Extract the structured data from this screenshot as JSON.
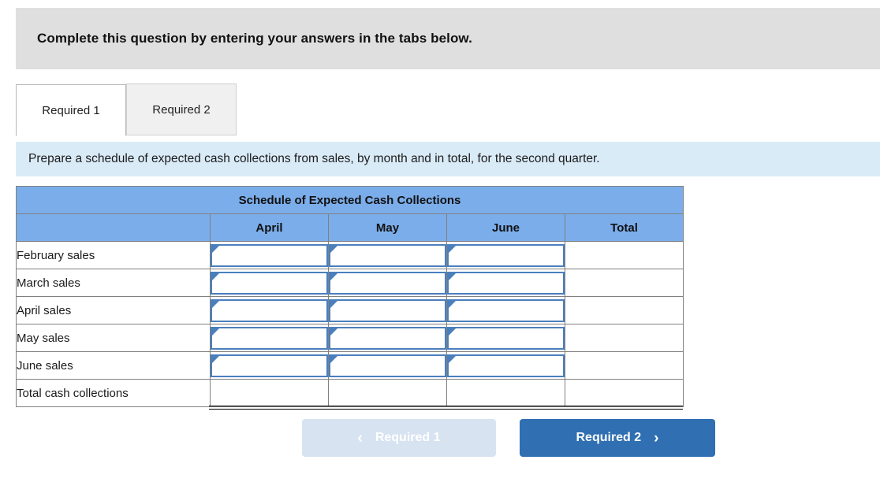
{
  "banner": {
    "text": "Complete this question by entering your answers in the tabs below."
  },
  "tabs": [
    {
      "label": "Required 1",
      "state": "active"
    },
    {
      "label": "Required 2",
      "state": "inactive"
    }
  ],
  "instruction": {
    "text": "Prepare a schedule of expected cash collections from sales, by month and in total, for the second quarter."
  },
  "worksheet": {
    "title": "Schedule of Expected Cash Collections",
    "columns": [
      "",
      "April",
      "May",
      "June",
      "Total"
    ],
    "rows": [
      {
        "label": "February sales",
        "inputs": [
          "",
          "",
          ""
        ],
        "total": ""
      },
      {
        "label": "March sales",
        "inputs": [
          "",
          "",
          ""
        ],
        "total": ""
      },
      {
        "label": "April sales",
        "inputs": [
          "",
          "",
          ""
        ],
        "total": ""
      },
      {
        "label": "May sales",
        "inputs": [
          "",
          "",
          ""
        ],
        "total": ""
      },
      {
        "label": "June sales",
        "inputs": [
          "",
          "",
          ""
        ],
        "total": ""
      }
    ],
    "total_row": {
      "label": "Total cash collections",
      "values": [
        "",
        "",
        "",
        ""
      ]
    }
  },
  "nav": {
    "prev_label": "Required 1",
    "prev_chevron": "‹",
    "next_label": "Required 2",
    "next_chevron": "›"
  },
  "colors": {
    "banner_gray": "#dfdfdf",
    "instruction_blue": "#daebf8",
    "table_header_blue": "#7badea",
    "input_border_blue": "#4a7fbd",
    "button_active_blue": "#2f6fb2",
    "button_disabled_blue": "#d7e3f1"
  }
}
